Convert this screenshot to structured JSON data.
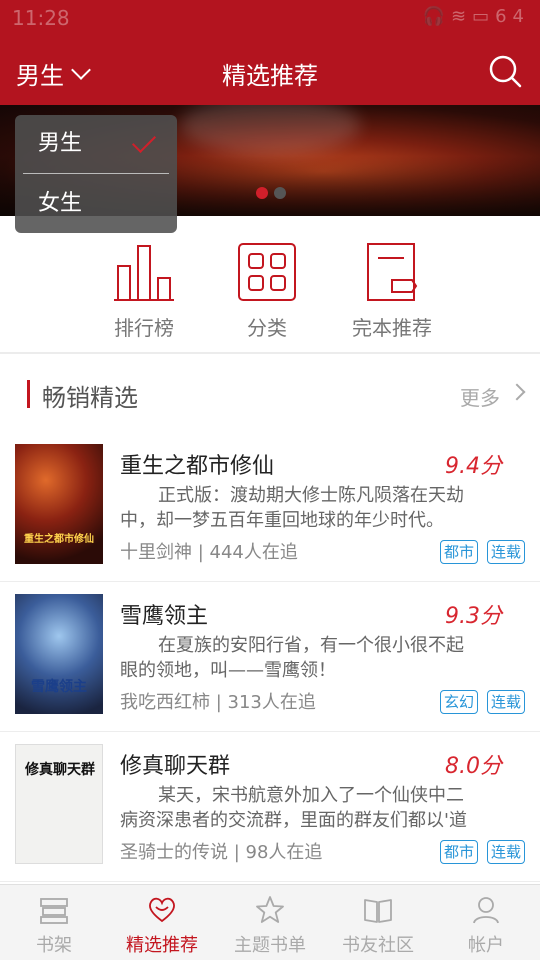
{
  "status_bar": {
    "time": "11:28",
    "battery": "64"
  },
  "header": {
    "gender_selected": "男生",
    "title": "精选推荐"
  },
  "dropdown": {
    "options": [
      "男生",
      "女生"
    ],
    "selected_index": 0
  },
  "banner": {
    "slide_count": 2,
    "active_slide": 0
  },
  "quick_nav": [
    {
      "label": "排行榜",
      "icon": "ranking-icon"
    },
    {
      "label": "分类",
      "icon": "category-icon"
    },
    {
      "label": "完本推荐",
      "icon": "completed-book-icon"
    }
  ],
  "section": {
    "title": "畅销精选",
    "more": "更多"
  },
  "books": [
    {
      "title": "重生之都市修仙",
      "score": "9.4分",
      "desc": "正式版：渡劫期大修士陈凡陨落在天劫中，却一梦五百年重回地球的年少时代。",
      "meta": "十里剑神 | 444人在追",
      "tags": [
        "都市",
        "连载"
      ]
    },
    {
      "title": "雪鹰领主",
      "score": "9.3分",
      "desc": "在夏族的安阳行省，有一个很小很不起眼的领地，叫——雪鹰领！",
      "meta": "我吃西红柿 | 313人在追",
      "tags": [
        "玄幻",
        "连载"
      ]
    },
    {
      "title": "修真聊天群",
      "score": "8.0分",
      "desc": "某天，宋书航意外加入了一个仙侠中二病资深患者的交流群，里面的群友们都以'道",
      "meta": "圣骑士的传说 | 98人在追",
      "tags": [
        "都市",
        "连载"
      ]
    }
  ],
  "bottom_nav": [
    {
      "label": "书架",
      "icon": "bookshelf-icon",
      "active": false
    },
    {
      "label": "精选推荐",
      "icon": "heart-icon",
      "active": true
    },
    {
      "label": "主题书单",
      "icon": "star-icon",
      "active": false
    },
    {
      "label": "书友社区",
      "icon": "open-book-icon",
      "active": false
    },
    {
      "label": "帐户",
      "icon": "user-icon",
      "active": false
    }
  ],
  "colors": {
    "brand": "#b3141f",
    "accent": "#d8262f",
    "tag": "#2895d8"
  }
}
